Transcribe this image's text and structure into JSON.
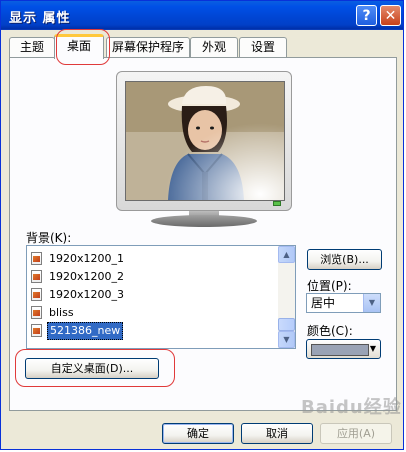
{
  "window": {
    "title": "显示 属性",
    "help_glyph": "?",
    "close_glyph": "✕"
  },
  "tabs": [
    {
      "label": "主题",
      "active": false
    },
    {
      "label": "桌面",
      "active": true
    },
    {
      "label": "屏幕保护程序",
      "active": false
    },
    {
      "label": "外观",
      "active": false
    },
    {
      "label": "设置",
      "active": false
    }
  ],
  "desktop": {
    "background_label": "背景(K):",
    "backgrounds": [
      {
        "name": "1920x1200_1",
        "selected": false
      },
      {
        "name": "1920x1200_2",
        "selected": false
      },
      {
        "name": "1920x1200_3",
        "selected": false
      },
      {
        "name": "bliss",
        "selected": false
      },
      {
        "name": "521386_new",
        "selected": true
      }
    ],
    "browse_label": "浏览(B)...",
    "position_label": "位置(P):",
    "position_value": "居中",
    "color_label": "颜色(C):",
    "color_value": "#9aa3b5",
    "customize_label": "自定义桌面(D)..."
  },
  "footer": {
    "ok_label": "确定",
    "cancel_label": "取消",
    "apply_label": "应用(A)"
  },
  "watermark": "Baidu经验",
  "colors": {
    "titlebar": "#0046d5",
    "accent_tab": "#ffc83c",
    "selection": "#316ac5",
    "annotation": "#e03a3a"
  }
}
